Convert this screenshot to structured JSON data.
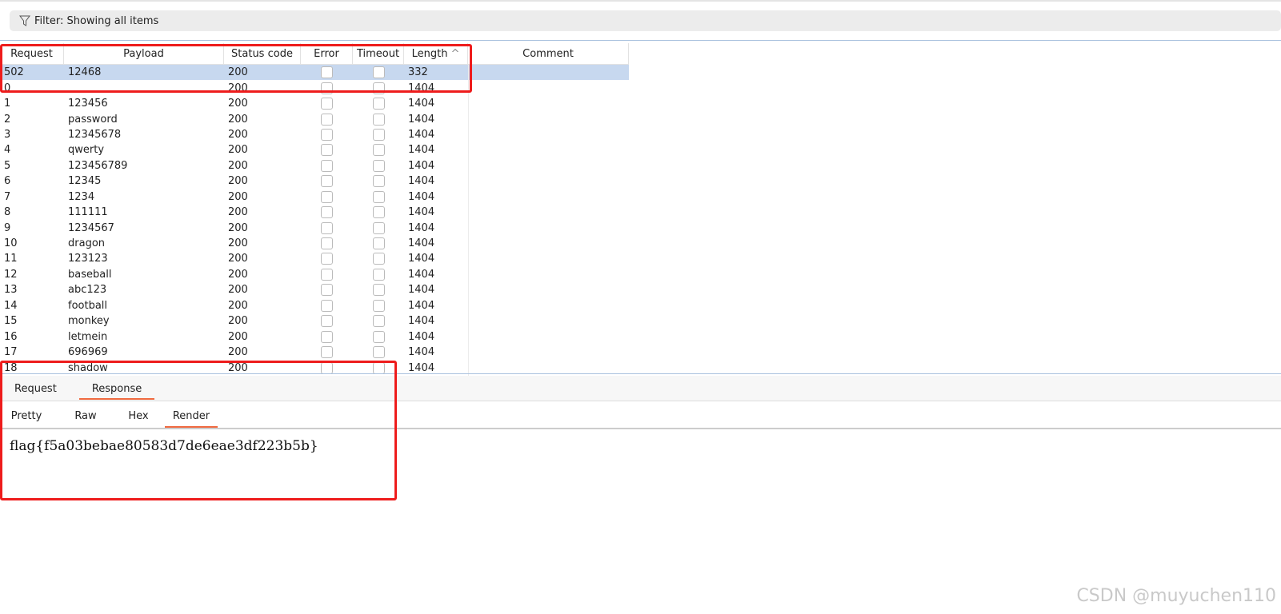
{
  "filter": {
    "label": "Filter: Showing all items"
  },
  "table": {
    "columns": [
      "Request",
      "Payload",
      "Status code",
      "Error",
      "Timeout",
      "Length",
      "Comment"
    ],
    "sort_icon": "chevron-up-icon",
    "rows": [
      [
        "502",
        "12468",
        "200",
        "332"
      ],
      [
        "0",
        "",
        "200",
        "1404"
      ],
      [
        "1",
        "123456",
        "200",
        "1404"
      ],
      [
        "2",
        "password",
        "200",
        "1404"
      ],
      [
        "3",
        "12345678",
        "200",
        "1404"
      ],
      [
        "4",
        "qwerty",
        "200",
        "1404"
      ],
      [
        "5",
        "123456789",
        "200",
        "1404"
      ],
      [
        "6",
        "12345",
        "200",
        "1404"
      ],
      [
        "7",
        "1234",
        "200",
        "1404"
      ],
      [
        "8",
        "111111",
        "200",
        "1404"
      ],
      [
        "9",
        "1234567",
        "200",
        "1404"
      ],
      [
        "10",
        "dragon",
        "200",
        "1404"
      ],
      [
        "11",
        "123123",
        "200",
        "1404"
      ],
      [
        "12",
        "baseball",
        "200",
        "1404"
      ],
      [
        "13",
        "abc123",
        "200",
        "1404"
      ],
      [
        "14",
        "football",
        "200",
        "1404"
      ],
      [
        "15",
        "monkey",
        "200",
        "1404"
      ],
      [
        "16",
        "letmein",
        "200",
        "1404"
      ],
      [
        "17",
        "696969",
        "200",
        "1404"
      ],
      [
        "18",
        "shadow",
        "200",
        "1404"
      ]
    ]
  },
  "tabs": [
    "Request",
    "Response"
  ],
  "subtabs": [
    "Pretty",
    "Raw",
    "Hex",
    "Render"
  ],
  "render_text": "flag{f5a03bebae80583d7de6eae3df223b5b}",
  "watermark": "CSDN @muyuchen110",
  "colors": {
    "accent": "#f06a40",
    "selected": "#c7d8ef",
    "annotation": "#ee1c1c"
  }
}
